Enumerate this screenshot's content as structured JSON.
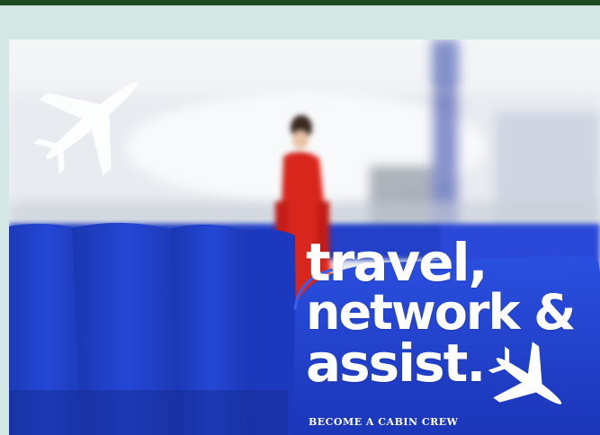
{
  "ad": {
    "headline_line1": "travel,",
    "headline_line2": "network &",
    "headline_line3": "assist.",
    "subline": "BECOME A CABIN CREW"
  },
  "icons": {
    "top_left": "airplane-icon",
    "bottom_right": "airplane-icon"
  },
  "colors": {
    "top_bar": "#1d4a22",
    "page_background": "#d3e7e5",
    "seat_blue": "#1e3fc4",
    "uniform_red": "#d8261f",
    "text": "#ffffff"
  }
}
